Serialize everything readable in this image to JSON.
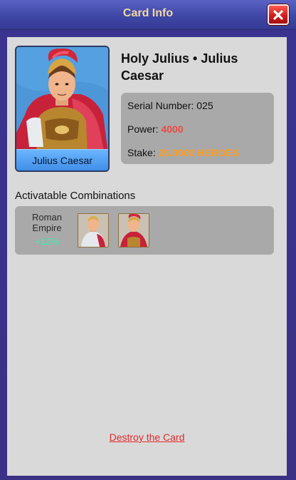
{
  "window": {
    "title": "Card Info",
    "close_icon": "close-x-icon",
    "accent_title_color": "#f2d9a6",
    "close_button_color": "#d11d1d"
  },
  "card": {
    "portrait_name": "Julius Caesar",
    "title": "Holy Julius • Julius Caesar",
    "serial_label": "Serial Number: ",
    "serial_value": "025",
    "power_label": "Power: ",
    "power_value": "4000",
    "stake_label": "Stake: ",
    "stake_value": "20.0000 HEROES",
    "power_color": "#f0473f",
    "stake_color": "#ff9d1f"
  },
  "combinations": {
    "label": "Activatable Combinations",
    "items": [
      {
        "name": "Roman Empire",
        "bonus": "+12%",
        "bonus_color": "#2ef3b4",
        "heroes": [
          "hero-portrait-white",
          "hero-portrait-red"
        ]
      }
    ]
  },
  "actions": {
    "destroy_label": "Destroy the Card",
    "destroy_color": "#e22a2a"
  }
}
